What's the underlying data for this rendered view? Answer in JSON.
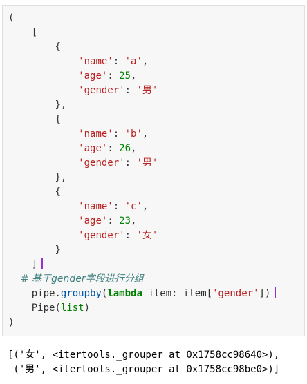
{
  "code": {
    "open_paren": "(",
    "open_bracket": "[",
    "dict_open": "{",
    "dict_close_comma": "},",
    "dict_close": "}",
    "close_bracket": "]",
    "close_paren": ")",
    "key_name": "'name'",
    "key_age": "'age'",
    "key_gender": "'gender'",
    "colon": ": ",
    "comma": ",",
    "records": [
      {
        "name": "'a'",
        "age": "25",
        "gender": "'男'"
      },
      {
        "name": "'b'",
        "age": "26",
        "gender": "'男'"
      },
      {
        "name": "'c'",
        "age": "23",
        "gender": "'女'"
      }
    ],
    "comment": "# 基于gender字段进行分组",
    "groupby_obj": "pipe",
    "groupby_dot": ".",
    "groupby_method": "groupby",
    "groupby_open": "(",
    "lambda_kw": "lambda",
    "lambda_rest": " item: item[",
    "lambda_key": "'gender'",
    "lambda_close": "])",
    "pipe_call": "Pipe(",
    "pipe_arg": "list",
    "pipe_close": ")"
  },
  "output": {
    "line1": "[('女', <itertools._grouper at 0x1758cc98640>),",
    "line2": " ('男', <itertools._grouper at 0x1758cc98be0>)]"
  }
}
